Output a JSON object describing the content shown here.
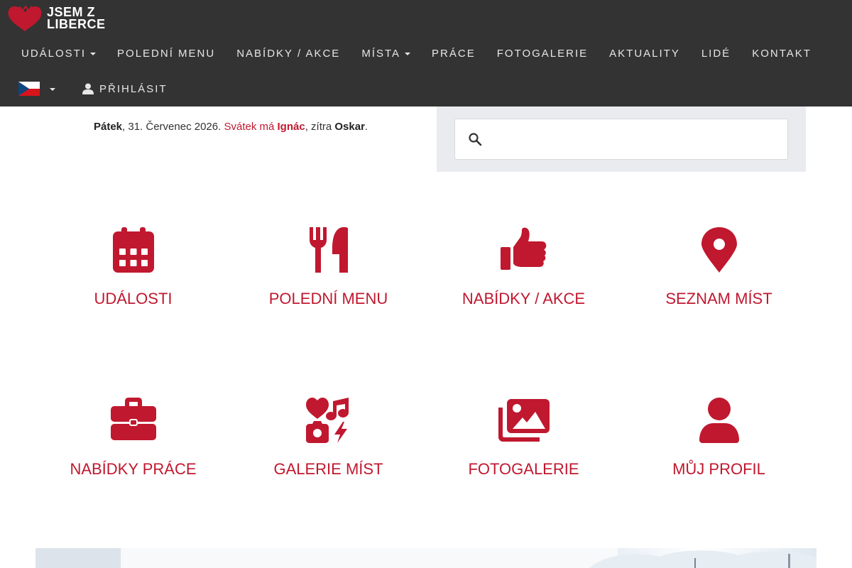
{
  "brand": {
    "logo_text_line1": "JSEM Z",
    "logo_text_line2": "LIBERCE"
  },
  "colors": {
    "header_bg": "#333333",
    "accent": "#c0182f",
    "search_panel_bg": "#e9ebef"
  },
  "nav": {
    "items": [
      {
        "label": "UDÁLOSTI",
        "dropdown": true
      },
      {
        "label": "POLEDNÍ MENU",
        "dropdown": false
      },
      {
        "label": "NABÍDKY / AKCE",
        "dropdown": false
      },
      {
        "label": "MÍSTA",
        "dropdown": true
      },
      {
        "label": "PRÁCE",
        "dropdown": false
      },
      {
        "label": "FOTOGALERIE",
        "dropdown": false
      },
      {
        "label": "AKTUALITY",
        "dropdown": false
      },
      {
        "label": "LIDÉ",
        "dropdown": false
      },
      {
        "label": "KONTAKT",
        "dropdown": false
      }
    ],
    "language_flag": "czech-flag-icon",
    "login_label": "PŘIHLÁSIT"
  },
  "info": {
    "day": "Pátek",
    "date_text": ", 31. Červenec 2026. ",
    "nameday_prefix": "Svátek má ",
    "nameday_today": "Ignác",
    "tomorrow_prefix": ", zítra ",
    "nameday_tomorrow": "Oskar",
    "end": "."
  },
  "search": {
    "icon": "search-icon",
    "placeholder": ""
  },
  "tiles": [
    {
      "label": "UDÁLOSTI",
      "icon": "calendar-icon"
    },
    {
      "label": "POLEDNÍ MENU",
      "icon": "utensils-icon"
    },
    {
      "label": "NABÍDKY / AKCE",
      "icon": "thumbs-up-icon"
    },
    {
      "label": "SEZNAM MÍST",
      "icon": "map-marker-icon"
    },
    {
      "label": "NABÍDKY PRÁCE",
      "icon": "briefcase-icon"
    },
    {
      "label": "GALERIE MÍST",
      "icon": "icons-mix-icon"
    },
    {
      "label": "FOTOGALERIE",
      "icon": "images-icon"
    },
    {
      "label": "MŮJ PROFIL",
      "icon": "user-icon"
    }
  ]
}
